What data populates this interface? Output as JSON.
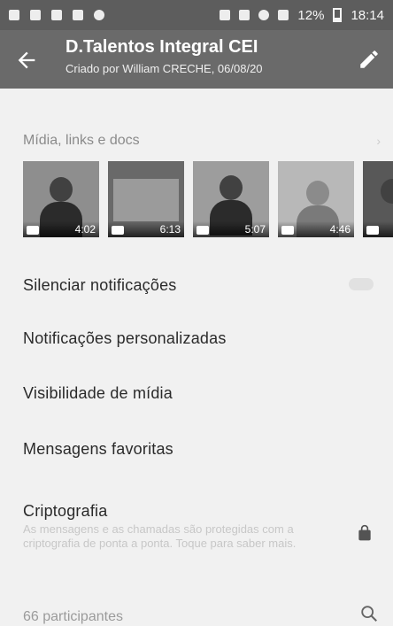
{
  "status_bar": {
    "battery_percent": "12%",
    "time": "18:14"
  },
  "app_bar": {
    "title": "D.Talentos Integral CEI",
    "subtitle": "Criado por William CRECHE, 06/08/20",
    "back_icon": "arrow-left-icon",
    "edit_icon": "pencil-icon"
  },
  "media": {
    "header": "Mídia, links e docs",
    "thumbnails": [
      {
        "duration": "4:02"
      },
      {
        "duration": "6:13"
      },
      {
        "duration": "5:07"
      },
      {
        "duration": "4:46"
      },
      {
        "duration": ""
      }
    ]
  },
  "settings": {
    "mute": "Silenciar notificações",
    "custom_notifications": "Notificações personalizadas",
    "media_visibility": "Visibilidade de mídia",
    "starred": "Mensagens favoritas",
    "encryption_title": "Criptografia",
    "encryption_desc": "As mensagens e as chamadas são protegidas com a criptografia de ponta a ponta. Toque para saber mais."
  },
  "participants": {
    "label": "66 participantes",
    "search_icon": "search-icon"
  },
  "colors": {
    "app_bar": "#6b6b6b",
    "status_bar": "#5f5f5f",
    "background": "#f1f1f1"
  }
}
